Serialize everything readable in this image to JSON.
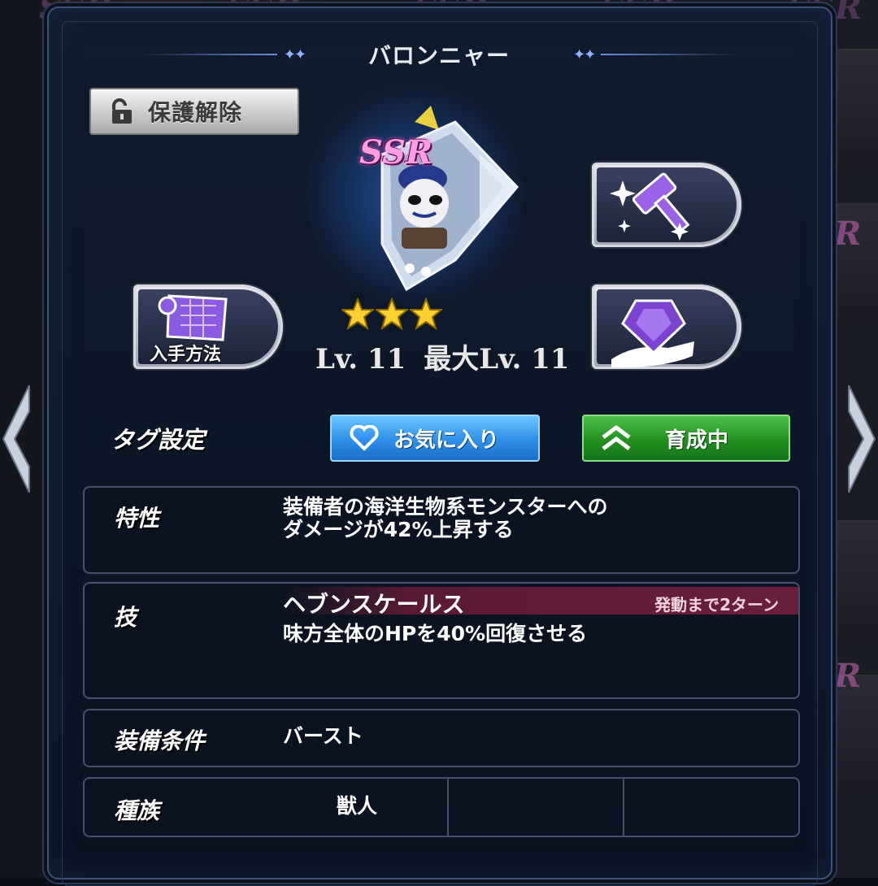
{
  "title": "バロンニャー",
  "protect_button": "保護解除",
  "item": {
    "rarity": "SSR",
    "stars": 3,
    "level": "Lv. 11",
    "max_level": "最大Lv. 11"
  },
  "buttons": {
    "acquire": "入手方法"
  },
  "tags": {
    "label": "タグ設定",
    "favorite": "お気に入り",
    "training": "育成中"
  },
  "trait": {
    "label": "特性",
    "line1": "装備者の海洋生物系モンスターへの",
    "line2": "ダメージが42%上昇する"
  },
  "skill": {
    "label": "技",
    "name": "ヘブンスケールス",
    "turns": "発動まで2ターン",
    "description": "味方全体のHPを40%回復させる"
  },
  "equip_condition": {
    "label": "装備条件",
    "value": "バースト"
  },
  "race": {
    "label": "種族",
    "value": "獣人"
  },
  "background": {
    "ssr": "SSR",
    "r": "R"
  },
  "colors": {
    "rarity": "#ff9ee0",
    "favorite_button": "#2e8ee8",
    "training_button": "#23901f",
    "skill_bar": "#6a1e3e"
  }
}
